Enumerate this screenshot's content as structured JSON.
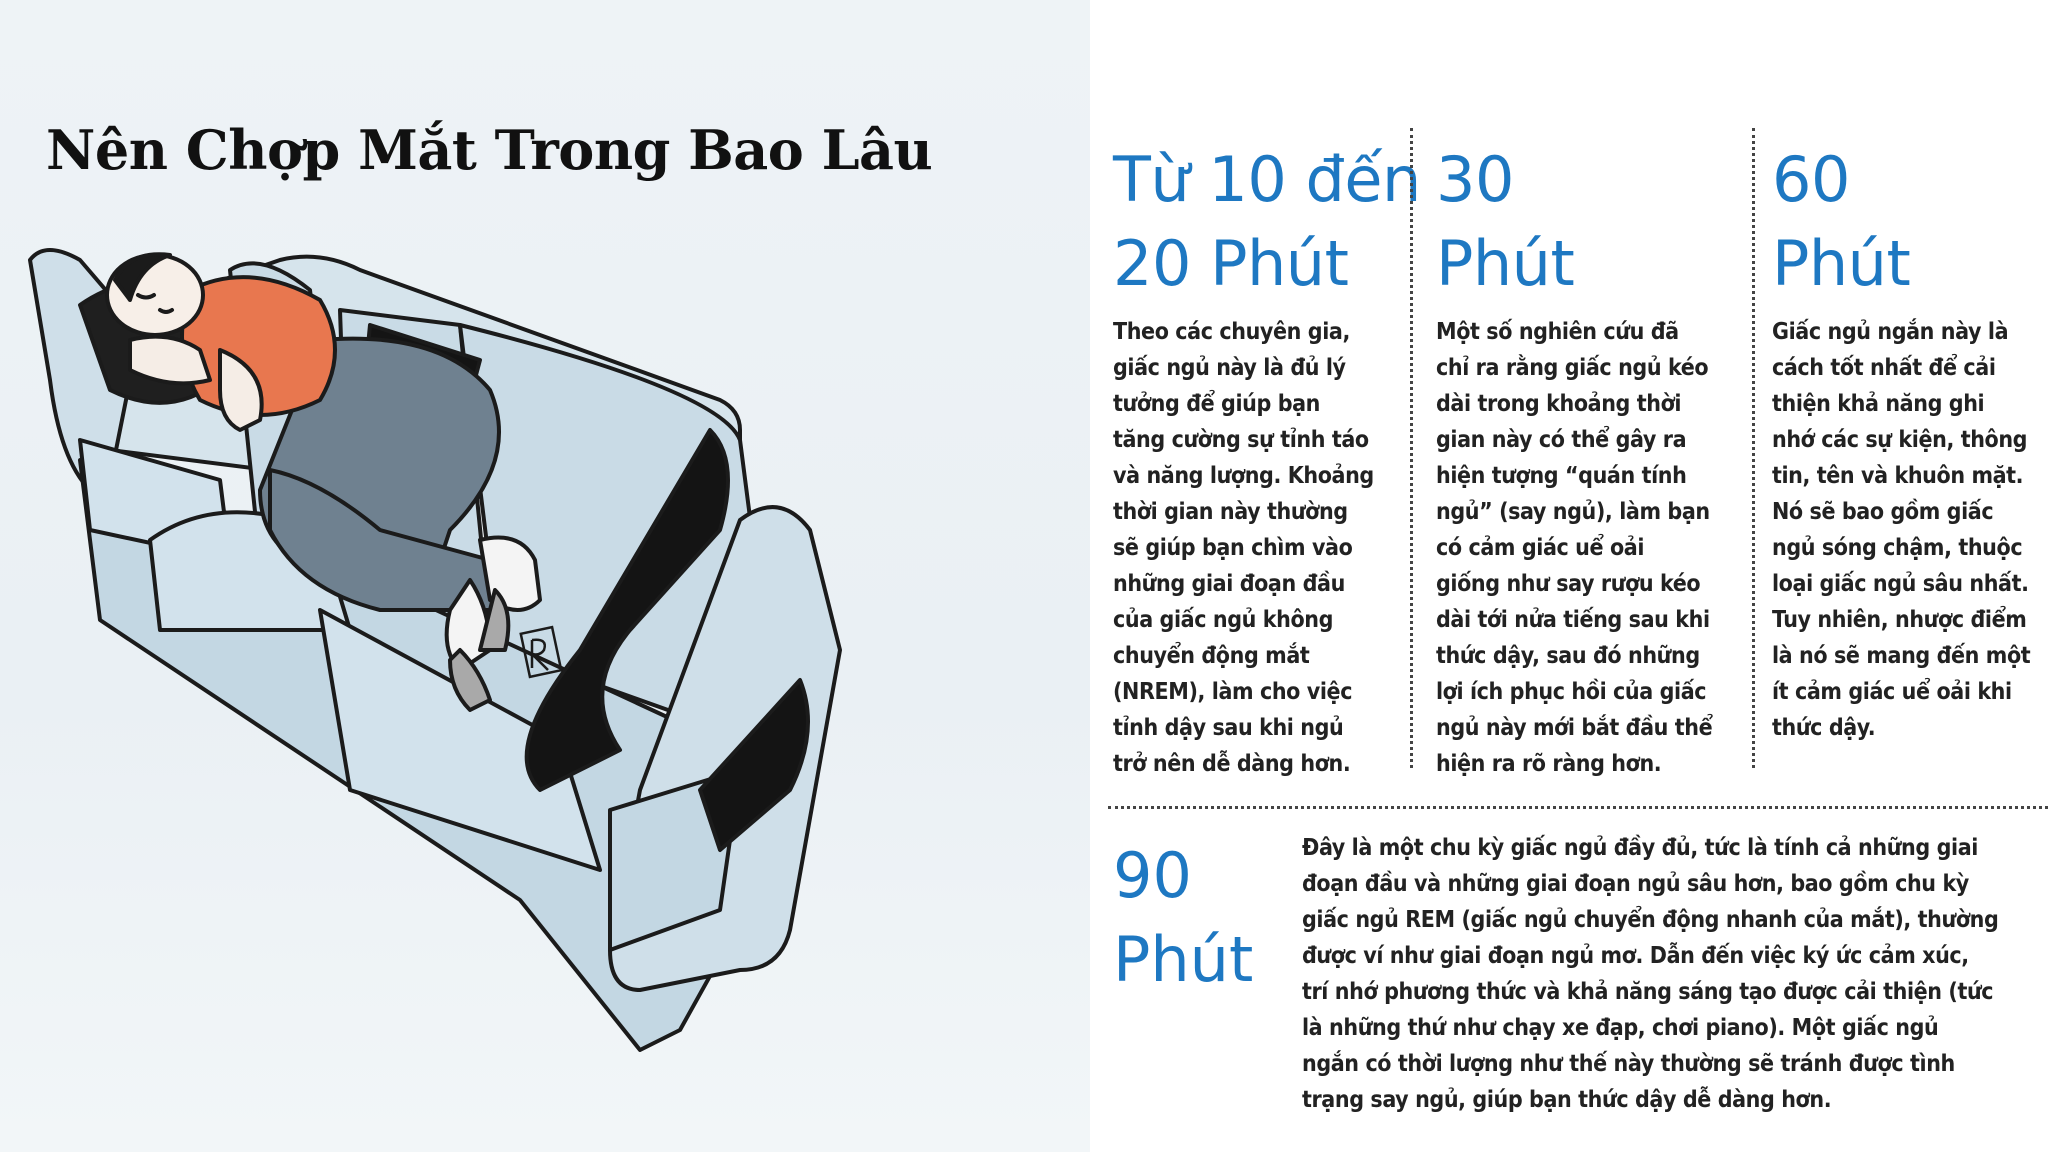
{
  "title": "Nên Chợp Mắt Trong Bao Lâu",
  "columns": [
    {
      "heading": "Từ 10 đến\n20 Phút",
      "text": "Theo các chuyên gia,\ngiấc ngủ này là đủ lý\ntưởng để giúp bạn\ntăng cường sự tỉnh táo\nvà năng lượng. Khoảng\nthời gian này thường\nsẽ giúp bạn chìm vào\nnhững giai đoạn đầu\ncủa giấc ngủ không\nchuyển động mắt\n(NREM), làm cho việc\ntỉnh dậy sau khi ngủ\ntrở nên dễ dàng hơn."
    },
    {
      "heading": "30\nPhút",
      "text": "Một số nghiên cứu đã\nchỉ ra rằng giấc ngủ kéo\ndài trong khoảng thời\ngian này có thể gây ra\nhiện tượng “quán tính\nngủ” (say ngủ), làm bạn\ncó cảm giác uể oải\ngiống như say rượu kéo\ndài tới nửa tiếng sau khi\nthức dậy, sau đó những\nlợi ích phục hồi của giấc\nngủ này mới bắt đầu thể\nhiện ra rõ ràng hơn."
    },
    {
      "heading": "60\nPhút",
      "text": "Giấc ngủ ngắn này là\ncách tốt nhất để cải\nthiện khả năng ghi\nnhớ các sự kiện, thông\ntin, tên và khuôn mặt.\nNó sẽ bao gồm giấc\nngủ sóng chậm, thuộc\nloại giấc ngủ sâu nhất.\nTuy nhiên, nhược điểm\nlà nó sẽ mang đến một\nít cảm giác uể oải khi\nthức dậy."
    }
  ],
  "bottom": {
    "heading": "90\nPhút",
    "text": "Đây là một chu kỳ giấc ngủ đầy đủ, tức là tính cả những giai\nđoạn đầu và những giai đoạn ngủ sâu hơn, bao gồm chu kỳ\ngiấc ngủ REM (giấc ngủ chuyển động nhanh của mắt), thường\nđược ví như giai đoạn ngủ mơ. Dẫn đến việc ký ức cảm xúc,\ntrí nhớ phương thức và khả năng sáng tạo được cải thiện (tức\nlà những thứ như chạy xe đạp, chơi piano). Một giấc ngủ\nngắn có thời lượng như thế này thường sẽ tránh được tình\ntrạng say ngủ, giúp bạn thức dậy dễ dàng hơn."
  },
  "colors": {
    "heading": "#1e78c2",
    "text": "#222222",
    "sofa": "#c9dbe6",
    "background": "#eaf0f4"
  },
  "icons": [
    "sleeping-person-on-sofa-illustration",
    "sofa-logo-icon"
  ]
}
